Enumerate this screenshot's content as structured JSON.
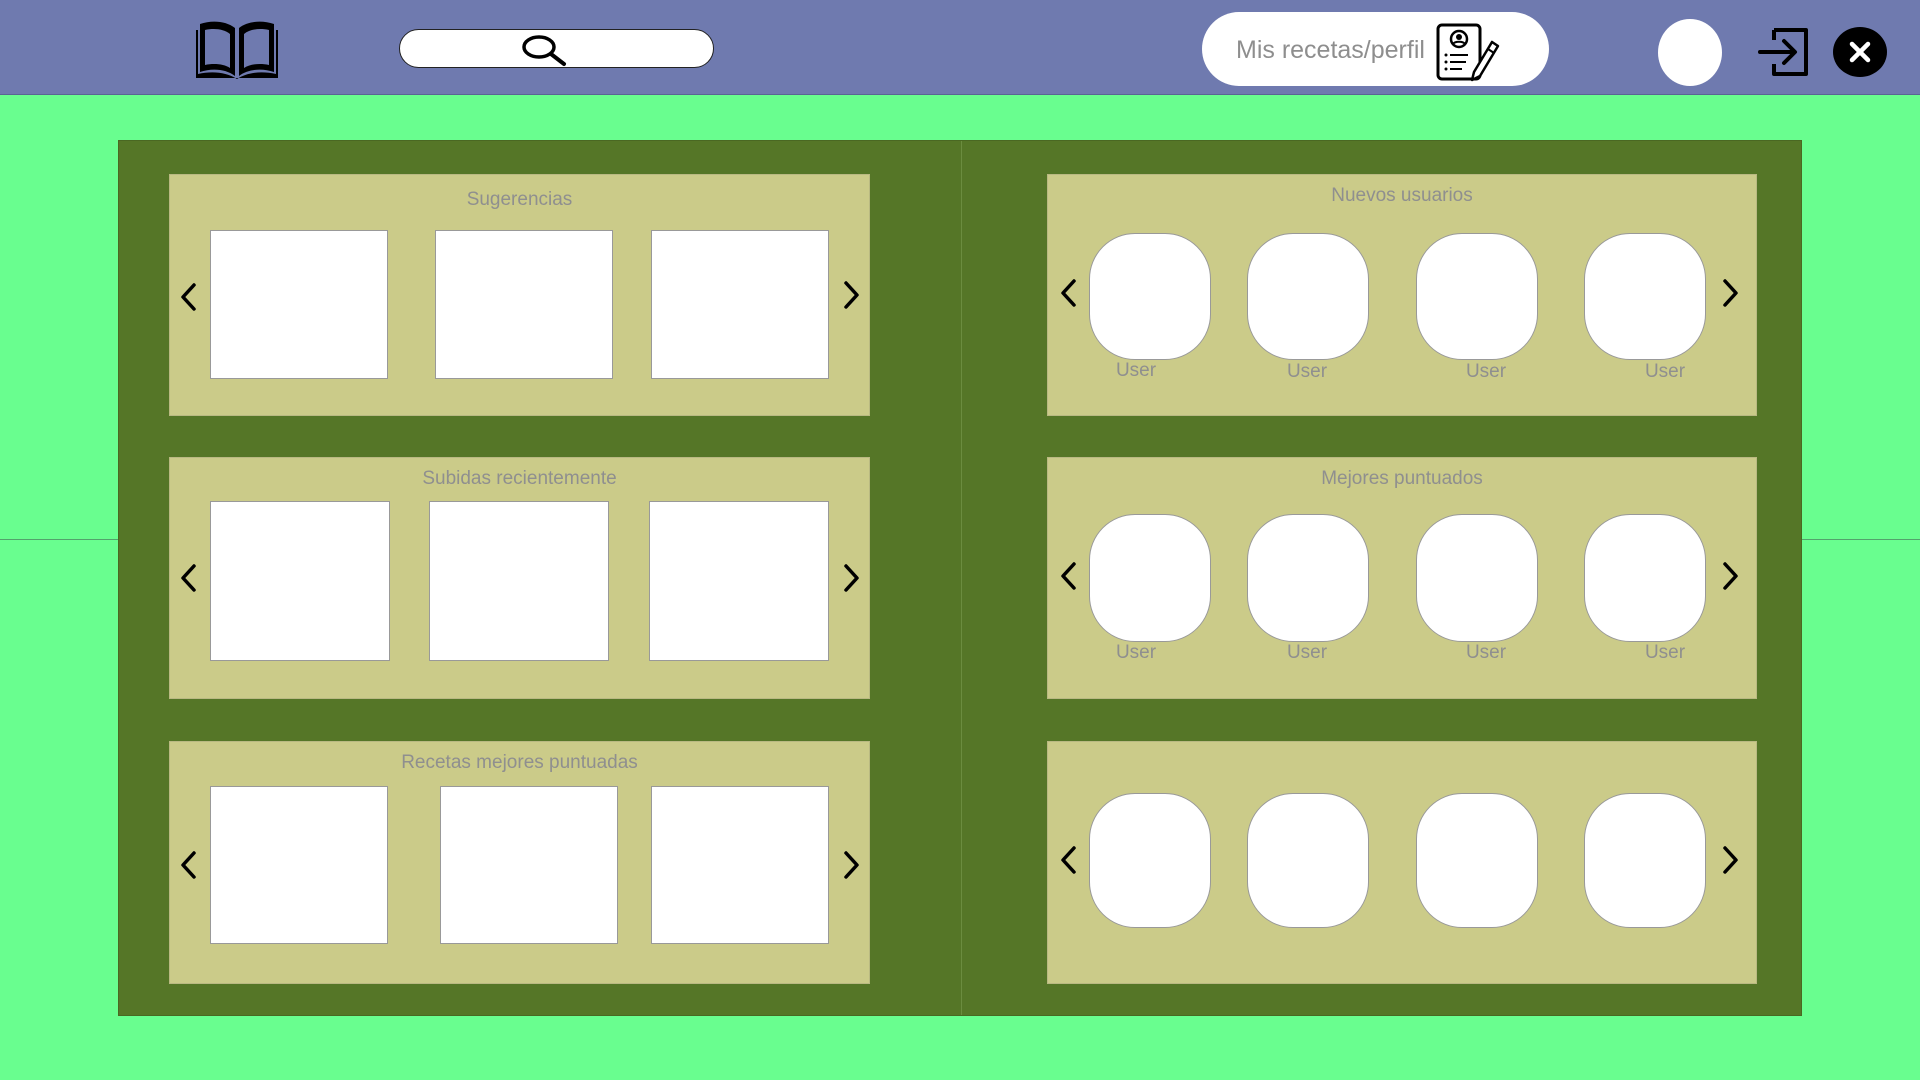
{
  "header": {
    "search_placeholder": "",
    "profile_button_label": "Mis recetas/perfil"
  },
  "colors": {
    "background": "#69fe8f",
    "topbar": "#6f7aaf",
    "book": "#557627",
    "panel": "#cbcb89",
    "label_text": "#8f8f8f"
  },
  "icons": {
    "logo": "open-book-icon",
    "search": "magnifier-icon",
    "profile": "profile-document-pencil-icon",
    "logout": "sign-in-arrow-icon",
    "close": "close-x-icon",
    "prev": "chevron-left-icon",
    "next": "chevron-right-icon"
  },
  "left_page": {
    "sections": [
      {
        "title": "Sugerencias",
        "card_count": 3
      },
      {
        "title": "Subidas recientemente",
        "card_count": 3
      },
      {
        "title": "Recetas mejores puntuadas",
        "card_count": 3
      }
    ]
  },
  "right_page": {
    "sections": [
      {
        "title": "Nuevos usuarios",
        "users": [
          "User",
          "User",
          "User",
          "User"
        ]
      },
      {
        "title": "Mejores puntuados",
        "users": [
          "User",
          "User",
          "User",
          "User"
        ]
      },
      {
        "title": "",
        "users": [
          "",
          "",
          "",
          ""
        ]
      }
    ]
  }
}
